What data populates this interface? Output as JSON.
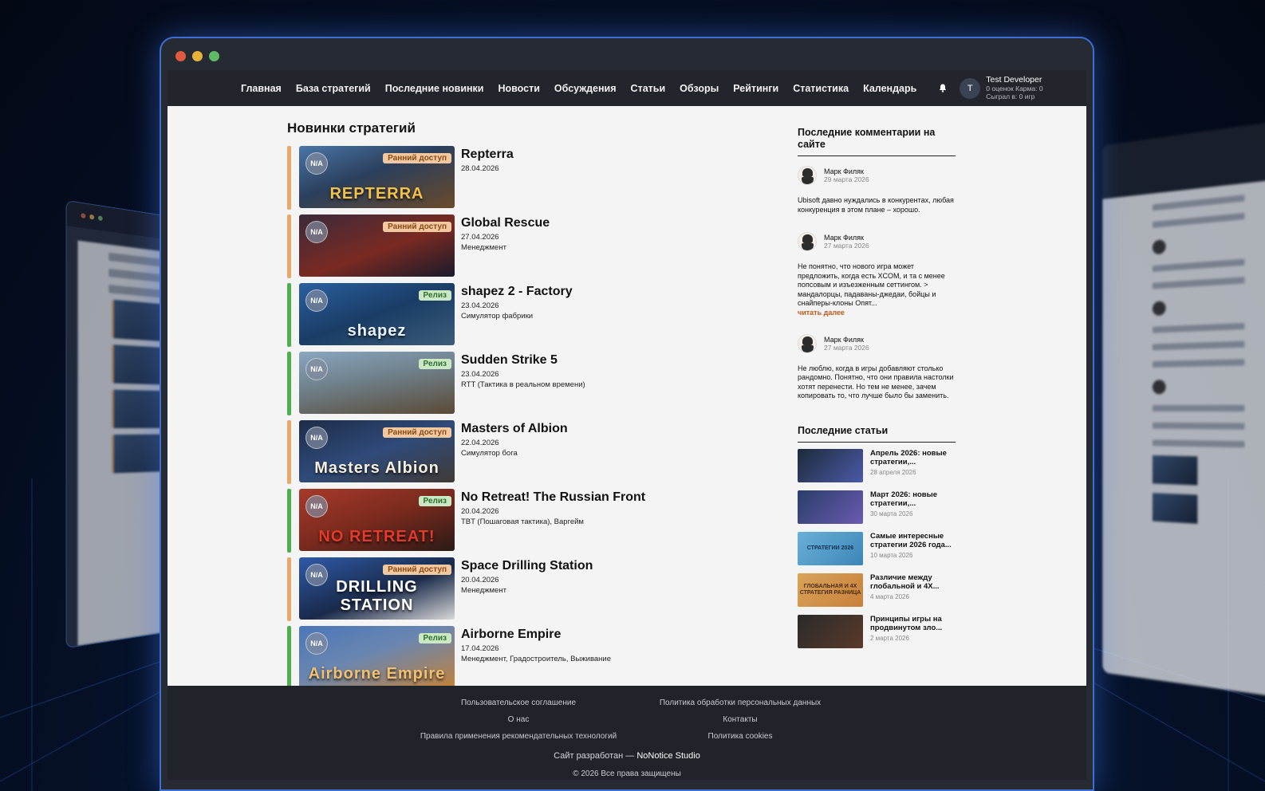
{
  "nav": {
    "items": [
      "Главная",
      "База стратегий",
      "Последние новинки",
      "Новости",
      "Обсуждения",
      "Статьи",
      "Обзоры",
      "Рейтинги",
      "Статистика",
      "Календарь"
    ]
  },
  "user": {
    "initial": "T",
    "name": "Test Developer",
    "stats_line1": "0 оценок Карма: 0",
    "stats_line2": "Сыграл в: 0 игр"
  },
  "main": {
    "title": "Новинки стратегий",
    "na_label": "N/A",
    "games": [
      {
        "name": "Repterra",
        "date": "28.04.2026",
        "genre": "",
        "badge": "Ранний доступ",
        "status": "early",
        "art": "REPTERRA"
      },
      {
        "name": "Global Rescue",
        "date": "27.04.2026",
        "genre": "Менеджмент",
        "badge": "Ранний доступ",
        "status": "early",
        "art": ""
      },
      {
        "name": "shapez 2 - Factory",
        "date": "23.04.2026",
        "genre": "Симулятор фабрики",
        "badge": "Релиз",
        "status": "release",
        "art": "shapez"
      },
      {
        "name": "Sudden Strike 5",
        "date": "23.04.2026",
        "genre": "RTT (Тактика в реальном времени)",
        "badge": "Релиз",
        "status": "release",
        "art": ""
      },
      {
        "name": "Masters of Albion",
        "date": "22.04.2026",
        "genre": "Симулятор бога",
        "badge": "Ранний доступ",
        "status": "early",
        "art": "Masters Albion"
      },
      {
        "name": "No Retreat! The Russian Front",
        "date": "20.04.2026",
        "genre": "TBT (Пошаговая тактика), Варгейм",
        "badge": "Релиз",
        "status": "release",
        "art": "NO RETREAT!"
      },
      {
        "name": "Space Drilling Station",
        "date": "20.04.2026",
        "genre": "Менеджмент",
        "badge": "Ранний доступ",
        "status": "early",
        "art": "DRILLING STATION"
      },
      {
        "name": "Airborne Empire",
        "date": "17.04.2026",
        "genre": "Менеджмент, Градостроитель, Выживание",
        "badge": "Релиз",
        "status": "release",
        "art": "Airborne Empire"
      }
    ]
  },
  "sidebar": {
    "comments_title": "Последние комментарии на сайте",
    "comments": [
      {
        "author": "Марк Филяк",
        "date": "29 марта 2026",
        "text": "Ubisoft давно нуждались в конкурентах, любая конкуренция в этом плане – хорошо.",
        "more": ""
      },
      {
        "author": "Марк Филяк",
        "date": "27 марта 2026",
        "text": "Не понятно, что нового игра может предложить, когда есть XCOM, и та с менее попсовым и изъезженным сеттингом. > мандалорцы, падаваны-джедаи, бойцы и снайперы-клоны Опят...",
        "more": "читать далее"
      },
      {
        "author": "Марк Филяк",
        "date": "27 марта 2026",
        "text": "Не люблю, когда в игры добавляют столько рандомно. Понятно, что они правила настолки хотят перенести. Но тем не менее, зачем копировать то, что лучше было бы заменить.",
        "more": ""
      }
    ],
    "articles_title": "Последние статьи",
    "articles": [
      {
        "title": "Апрель 2026: новые стратегии,...",
        "date": "28 апреля 2026",
        "thumb": ""
      },
      {
        "title": "Март 2026: новые стратегии,...",
        "date": "30 марта 2026",
        "thumb": ""
      },
      {
        "title": "Самые интересные стратегии 2026 года...",
        "date": "10 марта 2026",
        "thumb": "СТРАТЕГИИ 2026"
      },
      {
        "title": "Различие между глобальной и 4X...",
        "date": "4 марта 2026",
        "thumb": "ГЛОБАЛЬНАЯ И 4X СТРАТЕГИЯ РАЗНИЦА"
      },
      {
        "title": "Принципы игры на продвинутом зло...",
        "date": "2 марта 2026",
        "thumb": ""
      }
    ]
  },
  "footer": {
    "left_links": [
      "Пользовательское соглашение",
      "О нас",
      "Правила применения рекомендательных технологий"
    ],
    "right_links": [
      "Политика обработки персональных данных",
      "Контакты",
      "Политика cookies"
    ],
    "dev_prefix": "Сайт разработан —",
    "dev_name": "NoNotice Studio",
    "copyright": "© 2026 Все права защищены"
  },
  "colors": {
    "early": "#e8a86a",
    "release": "#4caf50",
    "accent": "#3e6fd0"
  }
}
